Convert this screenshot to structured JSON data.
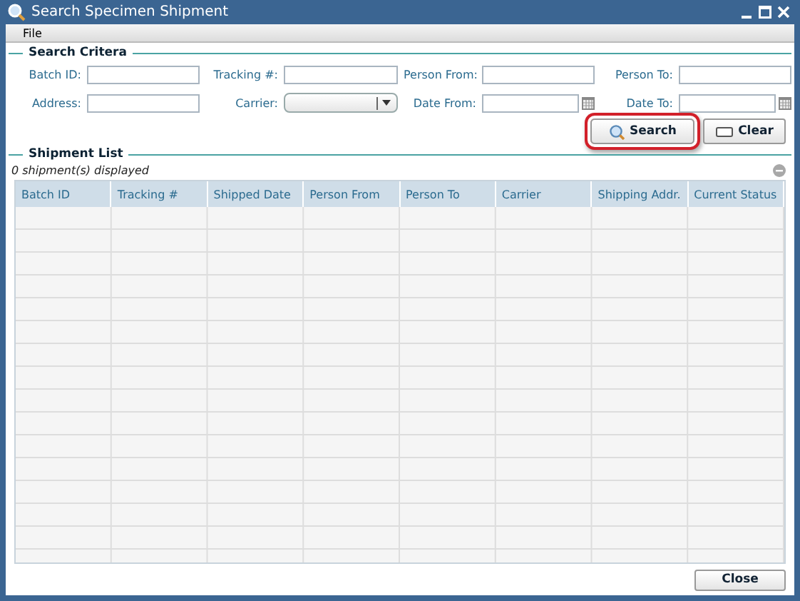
{
  "window": {
    "title": "Search Specimen Shipment"
  },
  "menu": [
    "File"
  ],
  "search_criteria": {
    "heading": "Search Critera",
    "fields": [
      {
        "label": "Batch ID:",
        "kind": "text"
      },
      {
        "label": "Tracking #:",
        "kind": "text"
      },
      {
        "label": "Person From:",
        "kind": "text"
      },
      {
        "label": "Person To:",
        "kind": "text"
      },
      {
        "label": "Address:",
        "kind": "text"
      },
      {
        "label": "Carrier:",
        "kind": "dropdown"
      },
      {
        "label": "Date From:",
        "kind": "date"
      },
      {
        "label": "Date To:",
        "kind": "date"
      }
    ],
    "buttons": [
      {
        "label": "Search",
        "kind": "search",
        "highlighted": true
      },
      {
        "label": "Clear",
        "kind": "clear",
        "highlighted": false
      }
    ]
  },
  "shipment_list": {
    "heading": "Shipment List",
    "count": "0 shipment(s) displayed",
    "columns": [
      "Batch ID",
      "Tracking #",
      "Shipped Date",
      "Person From",
      "Person To",
      "Carrier",
      "Shipping Addr.",
      "Current Status"
    ]
  },
  "buttons": [
    "Close"
  ]
}
